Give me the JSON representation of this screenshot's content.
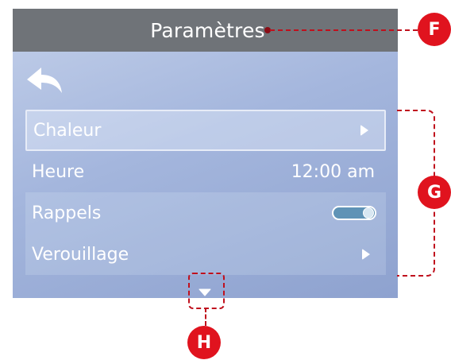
{
  "header": {
    "title": "Paramètres"
  },
  "nav": {
    "back_icon": "back-arrow-icon"
  },
  "menu": {
    "items": [
      {
        "label": "Chaleur",
        "value": "",
        "control": "arrow",
        "state": "selected"
      },
      {
        "label": "Heure",
        "value": "12:00 am",
        "control": "value",
        "state": "normal"
      },
      {
        "label": "Rappels",
        "value": "",
        "control": "toggle",
        "toggle_on": true,
        "state": "shaded"
      },
      {
        "label": "Verouillage",
        "value": "",
        "control": "arrow",
        "state": "shaded"
      }
    ],
    "scroll_icon": "scroll-down-arrow-icon"
  },
  "callouts": {
    "f": "F",
    "g": "G",
    "h": "H"
  },
  "colors": {
    "titlebar": "#6f7378",
    "callout": "#e0131e",
    "toggle": "#5f93b6"
  }
}
